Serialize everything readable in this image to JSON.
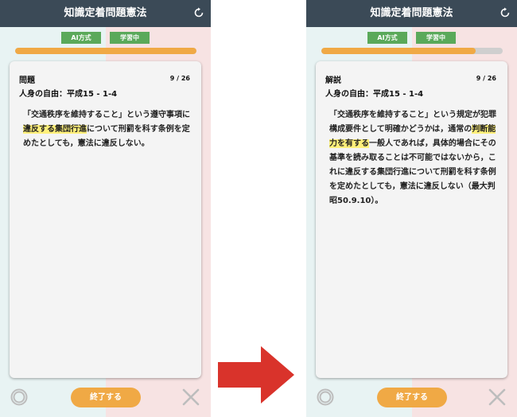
{
  "app": {
    "title": "知識定着問題憲法"
  },
  "badges": {
    "mode": "AI方式",
    "status": "学習中"
  },
  "question_screen": {
    "card_title": "問題",
    "counter": "9 / 26",
    "subtitle": "人身の自由：平成15 - 1-4",
    "text_before": "「交通秩序を維持すること」という遵守事項に",
    "highlight": "違反する集団行進",
    "text_after": "について刑罰を科す条例を定めたとしても，憲法に違反しない。",
    "progress": 1.0
  },
  "answer_screen": {
    "card_title": "解説",
    "counter": "9 / 26",
    "subtitle": "人身の自由：平成15 - 1-4",
    "text_before": "「交通秩序を維持すること」という規定が犯罪構成要件として明確かどうかは，通常の",
    "highlight": "判断能力を有する",
    "text_after": "一般人であれば，具体的場合にその基準を読み取ることは不可能ではないから，これに違反する集団行進について刑罰を科す条例を定めたとしても，憲法に違反しない（最大判昭50.9.10）。",
    "progress": 0.85
  },
  "footer": {
    "end_label": "終了する",
    "ok_icon": "circle-icon",
    "ng_icon": "cross-icon"
  },
  "colors": {
    "header": "#3b4a57",
    "accent": "#f0a945",
    "badge": "#5aa95a",
    "arrow": "#d9332b"
  }
}
